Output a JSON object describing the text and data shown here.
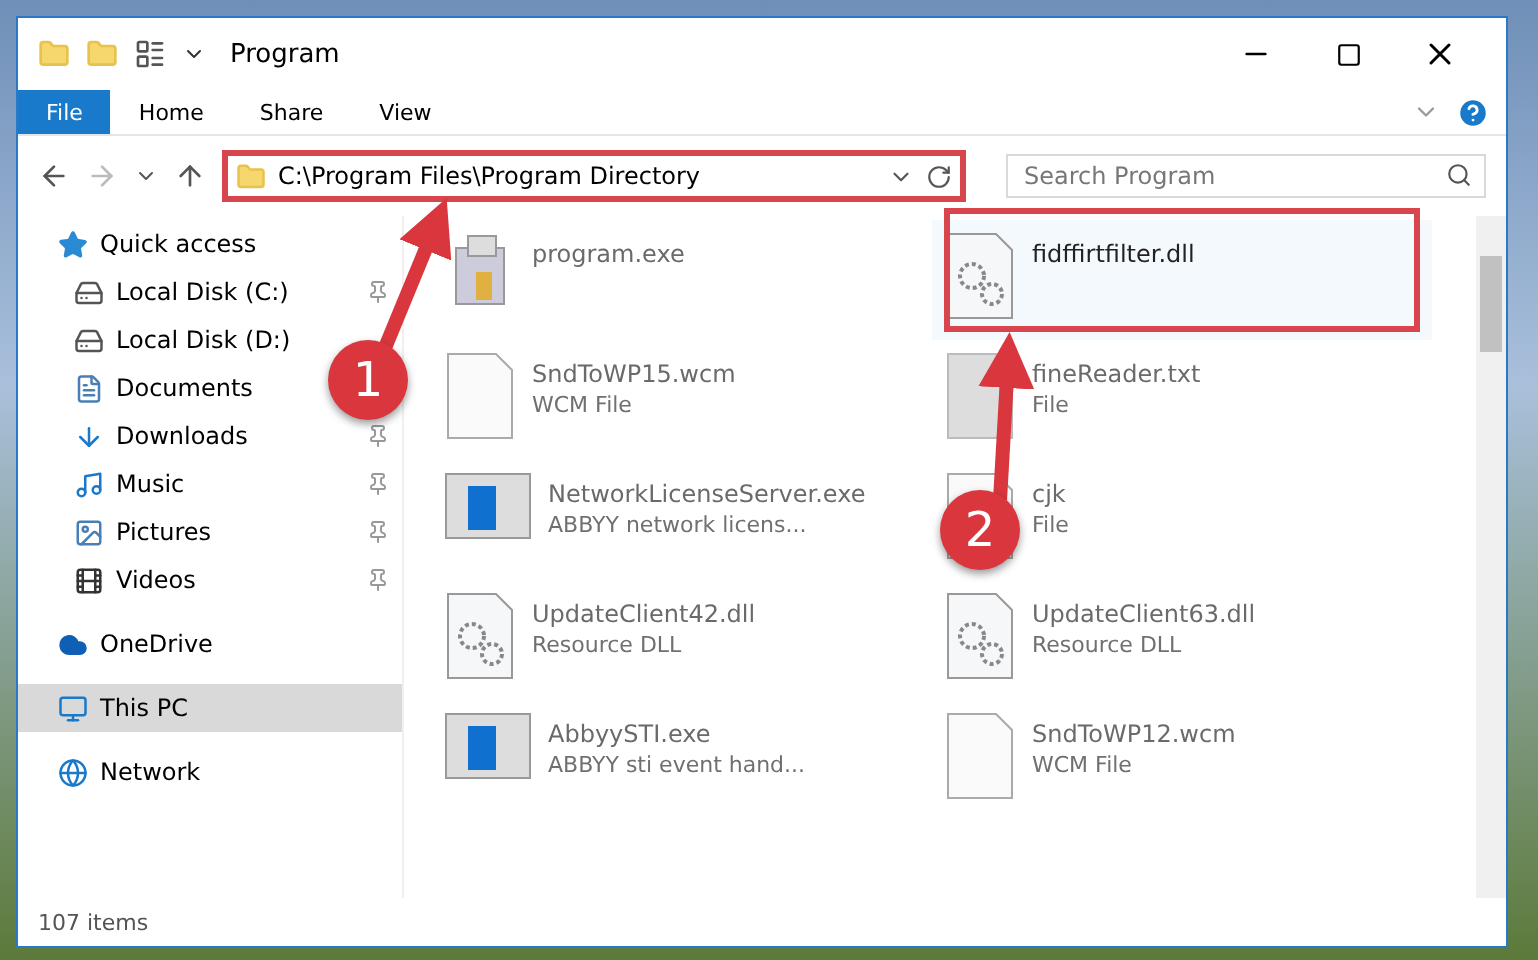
{
  "window": {
    "title": "Program"
  },
  "ribbon": {
    "tabs": [
      {
        "label": "File",
        "selected": true
      },
      {
        "label": "Home",
        "selected": false
      },
      {
        "label": "Share",
        "selected": false
      },
      {
        "label": "View",
        "selected": false
      }
    ]
  },
  "address_bar": {
    "path": "C:\\Program Files\\Program Directory"
  },
  "search": {
    "placeholder": "Search Program"
  },
  "sidebar": {
    "items": [
      {
        "label": "Quick access",
        "kind": "quick",
        "selected": false,
        "children": [
          {
            "label": "Local Disk (C:)",
            "kind": "disk",
            "pinned": true,
            "selected": false
          },
          {
            "label": "Local Disk (D:)",
            "kind": "disk",
            "pinned": false,
            "selected": false
          },
          {
            "label": "Documents",
            "kind": "documents",
            "pinned": false,
            "selected": false
          },
          {
            "label": "Downloads",
            "kind": "downloads",
            "pinned": true,
            "selected": false
          },
          {
            "label": "Music",
            "kind": "music",
            "pinned": true,
            "selected": false
          },
          {
            "label": "Pictures",
            "kind": "pictures",
            "pinned": true,
            "selected": false
          },
          {
            "label": "Videos",
            "kind": "videos",
            "pinned": true,
            "selected": false
          }
        ]
      },
      {
        "label": "OneDrive",
        "kind": "cloud",
        "selected": false
      },
      {
        "label": "This PC",
        "kind": "pc",
        "selected": true
      },
      {
        "label": "Network",
        "kind": "network",
        "selected": false
      }
    ]
  },
  "files": [
    {
      "name": "program.exe",
      "kind": "installer",
      "selected": false
    },
    {
      "name": "fidffirtfilter.dll",
      "kind": "dll",
      "selected": true
    },
    {
      "name": "SndToWP15.wcm",
      "description": "WCM File",
      "kind": "doc",
      "selected": false
    },
    {
      "name": "fineReader.txt",
      "description": "File",
      "kind": "blank",
      "selected": false
    },
    {
      "name": "NetworkLicenseServer.exe",
      "description": "ABBYY network licens...",
      "kind": "app",
      "selected": false
    },
    {
      "name": "cjk",
      "description": "File",
      "kind": "doc",
      "selected": false
    },
    {
      "name": "UpdateClient42.dll",
      "description": "Resource DLL",
      "kind": "dll",
      "selected": false
    },
    {
      "name": "UpdateClient63.dll",
      "description": "Resource DLL",
      "kind": "dll",
      "selected": false
    },
    {
      "name": "AbbyySTI.exe",
      "description": "ABBYY sti event hand...",
      "kind": "app",
      "selected": false
    },
    {
      "name": "SndToWP12.wcm",
      "description": "WCM File",
      "kind": "doc",
      "selected": false
    }
  ],
  "status_bar": {
    "count": "107 items"
  },
  "annotations": [
    {
      "number": "1"
    },
    {
      "number": "2"
    }
  ]
}
